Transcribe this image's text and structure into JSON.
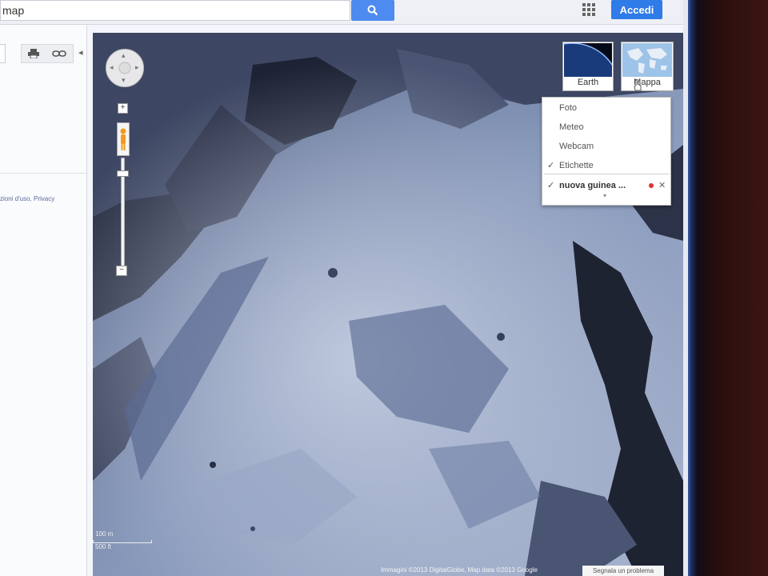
{
  "search": {
    "value": "map"
  },
  "header": {
    "login_label": "Accedi"
  },
  "left_panel": {
    "terms_text": "zioni d'uso, Privacy"
  },
  "map_type": {
    "earth_label": "Earth",
    "mappa_label": "Mappa"
  },
  "layers": {
    "items": [
      {
        "label": "Foto",
        "checked": false
      },
      {
        "label": "Meteo",
        "checked": false
      },
      {
        "label": "Webcam",
        "checked": false
      },
      {
        "label": "Etichette",
        "checked": true
      },
      {
        "label": "nuova guinea ...",
        "checked": true
      }
    ],
    "more_symbol": "▾"
  },
  "scale": {
    "metric": "100 m",
    "imperial": "500 ft"
  },
  "attribution": "Immagini ©2013 DigitalGlobe, Map data ©2013 Google",
  "report_link": "Segnala un problema",
  "colors": {
    "accent": "#2f7be8",
    "search_button": "#4d8bf0",
    "marker": "#e03030"
  },
  "icons": [
    "search-icon",
    "apps-grid-icon",
    "print-icon",
    "link-icon",
    "collapse-arrow-icon",
    "pan-control-icon",
    "pegman-icon",
    "check-icon",
    "close-icon"
  ]
}
